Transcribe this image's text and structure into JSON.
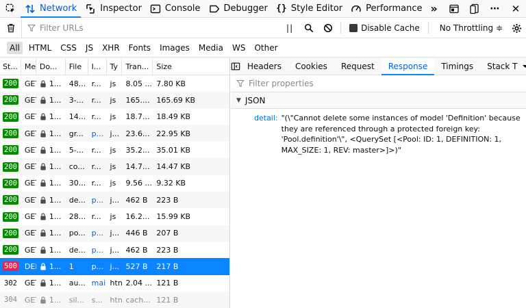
{
  "toolbox": {
    "tabs": [
      {
        "label": "Network",
        "icon": "network-icon",
        "active": true
      },
      {
        "label": "Inspector",
        "icon": "inspector-icon"
      },
      {
        "label": "Console",
        "icon": "console-icon"
      },
      {
        "label": "Debugger",
        "icon": "debugger-icon"
      },
      {
        "label": "Style Editor",
        "icon": "style-editor-icon"
      },
      {
        "label": "Performance",
        "icon": "performance-icon"
      }
    ],
    "more": "»"
  },
  "toolbar": {
    "filter_placeholder": "Filter URLs",
    "pause": "||",
    "disable_cache": "Disable Cache",
    "throttling": "No Throttling ≑"
  },
  "type_filters": [
    "All",
    "HTML",
    "CSS",
    "JS",
    "XHR",
    "Fonts",
    "Images",
    "Media",
    "WS",
    "Other"
  ],
  "columns": [
    "St...",
    "Me",
    "Do...",
    "File",
    "I...",
    "Ty",
    "Tran...",
    "Size"
  ],
  "rows": [
    {
      "status": "200",
      "method": "GET",
      "domain": "1...",
      "file": "48...",
      "init": "r...",
      "type": "js",
      "transferred": "8.05 ...",
      "size": "7.80 KB"
    },
    {
      "status": "200",
      "method": "GET",
      "domain": "1...",
      "file": "3-...",
      "init": "r...",
      "type": "js",
      "transferred": "165....",
      "size": "165.69 KB"
    },
    {
      "status": "200",
      "method": "GET",
      "domain": "1...",
      "file": "14...",
      "init": "r...",
      "type": "js",
      "transferred": "18.7...",
      "size": "18.49 KB"
    },
    {
      "status": "200",
      "method": "GET",
      "domain": "1...",
      "file": "gr...",
      "init": "p...",
      "type": "j...",
      "transferred": "23.6...",
      "size": "22.95 KB"
    },
    {
      "status": "200",
      "method": "GET",
      "domain": "1...",
      "file": "5-...",
      "init": "r...",
      "type": "js",
      "transferred": "35.2...",
      "size": "35.01 KB"
    },
    {
      "status": "200",
      "method": "GET",
      "domain": "1...",
      "file": "co...",
      "init": "r...",
      "type": "js",
      "transferred": "14.7...",
      "size": "14.47 KB"
    },
    {
      "status": "200",
      "method": "GET",
      "domain": "1...",
      "file": "30...",
      "init": "r...",
      "type": "js",
      "transferred": "9.56 ...",
      "size": "9.32 KB"
    },
    {
      "status": "200",
      "method": "GET",
      "domain": "1...",
      "file": "de...",
      "init": "p...",
      "type": "j...",
      "transferred": "462 B",
      "size": "223 B"
    },
    {
      "status": "200",
      "method": "GET",
      "domain": "1...",
      "file": "28...",
      "init": "r...",
      "type": "js",
      "transferred": "16.2...",
      "size": "15.99 KB"
    },
    {
      "status": "200",
      "method": "GET",
      "domain": "1...",
      "file": "po...",
      "init": "p...",
      "type": "j...",
      "transferred": "446 B",
      "size": "207 B"
    },
    {
      "status": "200",
      "method": "GET",
      "domain": "1...",
      "file": "de...",
      "init": "p...",
      "type": "j...",
      "transferred": "462 B",
      "size": "223 B"
    },
    {
      "status": "500",
      "method": "DEL",
      "domain": "1...",
      "file": "1",
      "init": "p...",
      "type": "j...",
      "transferred": "527 B",
      "size": "217 B"
    },
    {
      "status": "302",
      "method": "GET",
      "domain": "1...",
      "file": "au...",
      "init": "mai",
      "type": "htn",
      "transferred": "2.04 ...",
      "size": "121 B"
    },
    {
      "status": "304",
      "method": "GET",
      "domain": "1...",
      "file": "sil...",
      "init": "s...",
      "type": "htn",
      "transferred": "cach...",
      "size": "121 B"
    }
  ],
  "details": {
    "tabs": [
      "Headers",
      "Cookies",
      "Request",
      "Response",
      "Timings",
      "Stack T"
    ],
    "active_tab": "Response",
    "filter_placeholder": "Filter properties",
    "section": "JSON",
    "json_key": "detail:",
    "json_value": "\"(\\\"Cannot delete some instances of model 'Definition' because they are referenced through a protected foreign key: 'Pool.definition'\\\", <QuerySet [<Pool: ID: 1, DEFINITION: 1, MAX_SIZE: 1, REV: master>]>)\""
  },
  "colors": {
    "accent": "#0a84ff",
    "ok": "#058b00",
    "error": "#e22850"
  }
}
